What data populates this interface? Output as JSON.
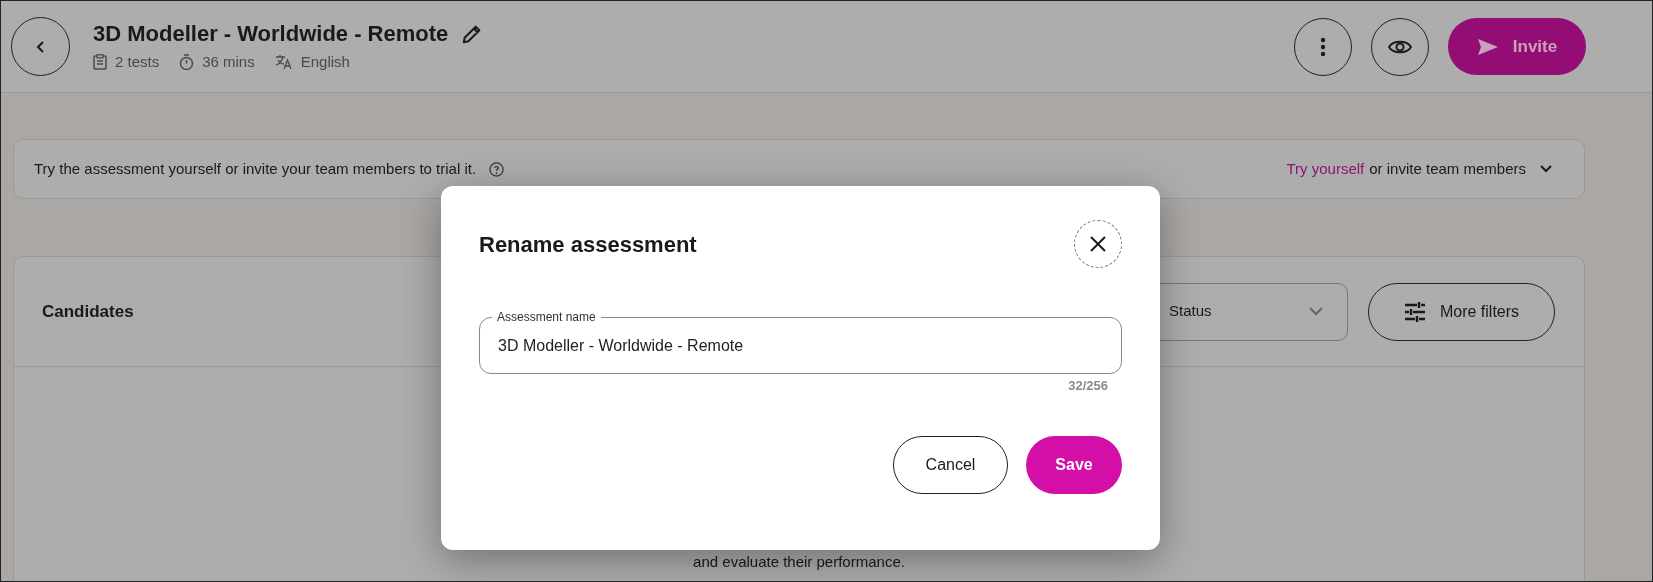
{
  "header": {
    "title": "3D Modeller - Worldwide - Remote",
    "meta": [
      {
        "kind": "tests",
        "text": "2 tests"
      },
      {
        "kind": "duration",
        "text": "36 mins"
      },
      {
        "kind": "language",
        "text": "English"
      }
    ],
    "invite_button": "Invite"
  },
  "banner": {
    "text": "Try the assessment yourself or invite your team members to trial it.",
    "link": "Try yourself",
    "trailing": "or invite team members"
  },
  "candidates": {
    "title": "Candidates",
    "status_filter": "Status",
    "more_filters": "More filters",
    "empty_text": "and evaluate their performance."
  },
  "dialog": {
    "title": "Rename assessment",
    "field_label": "Assessment name",
    "field_value": "3D Modeller - Worldwide - Remote",
    "counter": "32/256",
    "buttons": [
      {
        "kind": "secondary",
        "label": "Cancel"
      },
      {
        "kind": "primary",
        "label": "Save"
      }
    ]
  }
}
